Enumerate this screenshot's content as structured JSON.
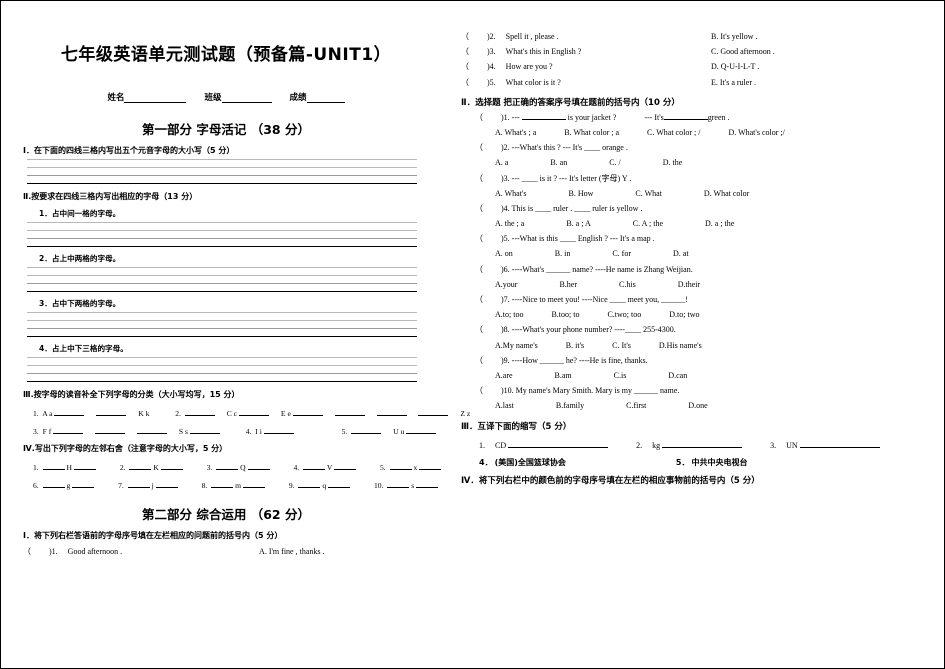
{
  "document": {
    "title": "七年级英语单元测试题（预备篇-UNIT1）",
    "info_fields": [
      {
        "label": "姓名"
      },
      {
        "label": "班级"
      },
      {
        "label": "成绩"
      }
    ]
  },
  "part1": {
    "title": "第一部分 字母活记 （38 分）",
    "section_I": {
      "heading": "Ⅰ．在下面的四线三格内写出五个元音字母的大小写（5 分）"
    },
    "section_II": {
      "heading": "Ⅱ.按要求在四线三格内写出相应的字母（13 分）",
      "items": [
        "1．占中间一格的字母。",
        "2．占上中两格的字母。",
        "3．占中下两格的字母。",
        "4．占上中下三格的字母。"
      ]
    },
    "section_III": {
      "heading": "Ⅲ.按字母的读音补全下列字母的分类（大小写均写，15 分）",
      "rows": [
        [
          {
            "num": "1.",
            "anchor": "A a",
            "blanks_before": 0,
            "blanks_after": 2,
            "tail": "K k"
          },
          {
            "num": "2.",
            "anchor": "C c",
            "blanks_before": 1,
            "blanks_after": 1,
            "tail": "E e"
          },
          {
            "num": "",
            "anchor": "Z z",
            "blanks_before": 4,
            "blanks_after": 0,
            "tail": ""
          }
        ],
        [
          {
            "num": "3.",
            "anchor": "F f",
            "blanks_before": 0,
            "blanks_after": 3,
            "tail": "S s"
          },
          {
            "num": "4.",
            "anchor": "I i",
            "blanks_before": 0,
            "blanks_after": 1,
            "tail": ""
          },
          {
            "num": "5.",
            "anchor": "U u",
            "blanks_before": 1,
            "blanks_after": 1,
            "tail": ""
          }
        ]
      ],
      "row1_text": "1. A a ___ ___ K k     2. ___ C c ___ E e ___ ___ ___ ___ Z z",
      "row2_text": "3. F f ___ ___ ___ S s ___     4. I i ___     5. ___ U u ___"
    },
    "section_IV": {
      "heading": "Ⅳ.写出下列字母的左邻右舍（注意字母的大小写，5 分）",
      "row1": [
        {
          "num": "1.",
          "letter": "H"
        },
        {
          "num": "2.",
          "letter": "K"
        },
        {
          "num": "3.",
          "letter": "Q"
        },
        {
          "num": "4.",
          "letter": "V"
        },
        {
          "num": "5.",
          "letter": "x"
        }
      ],
      "row2": [
        {
          "num": "6.",
          "letter": "g"
        },
        {
          "num": "7.",
          "letter": "j"
        },
        {
          "num": "8.",
          "letter": "m"
        },
        {
          "num": "9.",
          "letter": "q"
        },
        {
          "num": "10.",
          "letter": "s"
        }
      ]
    }
  },
  "part2": {
    "title": "第二部分 综合运用 （62 分）",
    "section_I": {
      "heading": "Ⅰ．将下列右栏答语前的字母序号填在左栏相应的问题前的括号内（5 分）",
      "items": [
        {
          "num": ")1.",
          "question": "Good   afternoon .",
          "option": "A. I'm   fine , thanks ."
        },
        {
          "num": ")2.",
          "question": "Spell   it , please .",
          "option": "B. It's   yellow ."
        },
        {
          "num": ")3.",
          "question": "What's   this   in   English ?",
          "option": "C. Good   afternoon ."
        },
        {
          "num": ")4.",
          "question": "How   are   you ?",
          "option": "D. Q-U-I-L-T ."
        },
        {
          "num": ")5.",
          "question": "What   color   is   it ?",
          "option": "E. It's   a   ruler ."
        }
      ]
    },
    "section_II": {
      "heading": "Ⅱ．选择题 把正确的答案序号填在题前的括号内（10 分）",
      "questions": [
        {
          "num": ")1.",
          "stem_pre": "--- ",
          "stem_post": " is   your   jacket ?",
          "stem_tail": "--- It's",
          "stem_tail2": "green .",
          "options": [
            "A. What's ; a",
            "B. What   color ; a",
            "C. What   color ; /",
            "D. What's color ;/"
          ]
        },
        {
          "num": ")2.",
          "text": "---What's   this ?        --- It's ____ orange .",
          "options": [
            "A. a",
            "B. an",
            "C. /",
            "D. the"
          ]
        },
        {
          "num": ")3.",
          "text": "--- ____ is   it ?        --- It's   letter (字母) Y .",
          "options": [
            "A. What's",
            "B. How",
            "C. What",
            "D. What   color"
          ]
        },
        {
          "num": ")4.",
          "text": "This   is ____ ruler . ____ ruler   is   yellow .",
          "options": [
            "A. the ; a",
            "B. a ; A",
            "C. A ; the",
            "D. a ; the"
          ]
        },
        {
          "num": ")5.",
          "text": "---What   is   this ____ English ?        --- It's   a   map .",
          "options": [
            "A. on",
            "B. in",
            "C. for",
            "D. at"
          ]
        },
        {
          "num": ")6.",
          "text": "----What's ______ name?  ----He   name   is   Zhang   Weijian.",
          "options": [
            "A.your",
            "B.her",
            "C.his",
            "D.their"
          ]
        },
        {
          "num": ")7.",
          "text": "----Nice   to   meet   you!        ----Nice ____ meet   you, ______!",
          "options": [
            "A.to;  too",
            "B.too;  to",
            "C.two;  too",
            "D.to;  two"
          ]
        },
        {
          "num": ")8.",
          "text": "----What's   your   phone   number?   ----____   255-4300.",
          "options": [
            "A.My   name's",
            "B. it's",
            "C. It's",
            "D.His   name's"
          ]
        },
        {
          "num": ")9.",
          "text": "----How ______ he?   ----He   is   fine,   thanks.",
          "options": [
            "A.are",
            "B.am",
            "C.is",
            "D.can"
          ]
        },
        {
          "num": ")10.",
          "text": "My   name's   Mary   Smith.   Mary   is   my ______ name.",
          "options": [
            "A.last",
            "B.family",
            "C.first",
            "D.one"
          ]
        }
      ]
    },
    "section_III": {
      "heading": "Ⅲ．互译下面的缩写（5 分）",
      "row1": [
        {
          "num": "1.",
          "text": "CD"
        },
        {
          "num": "2.",
          "text": "kg"
        },
        {
          "num": "3.",
          "text": "UN"
        }
      ],
      "row2": [
        {
          "num": "4．",
          "text": "(美国)全国篮球协会"
        },
        {
          "num": "5．",
          "text": "中共中央电视台"
        }
      ]
    },
    "section_IV": {
      "heading": "Ⅳ．将下列右栏中的颜色前的字母序号填在左栏的相应事物前的括号内（5 分）"
    }
  }
}
